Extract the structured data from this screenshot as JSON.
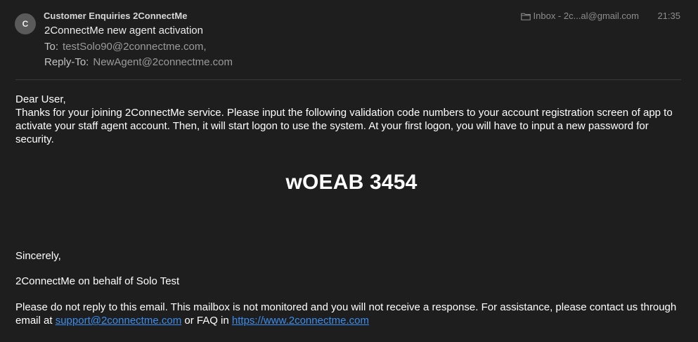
{
  "header": {
    "avatar_letter": "C",
    "sender": "Customer Enquiries 2ConnectMe",
    "subject": "2ConnectMe new agent activation",
    "to_label": "To:",
    "to_value": "testSolo90@2connectme.com,",
    "reply_to_label": "Reply-To:",
    "reply_to_value": "NewAgent@2connectme.com",
    "mailbox_icon": "folder-icon",
    "mailbox": "Inbox - 2c...al@gmail.com",
    "time": "21:35"
  },
  "body": {
    "greeting": "Dear User,",
    "paragraph": "Thanks for your joining 2ConnectMe service. Please input the following validation code numbers to your account registration screen of app to activate your staff agent account. Then, it will start logon to use the system. At your first logon, you will have to input a new password for security.",
    "code": "wOEAB 3454",
    "sincerely": "Sincerely,",
    "signature": "2ConnectMe on behalf of Solo Test",
    "footer_text_1": "Please do not reply to this email. This mailbox is not monitored and you will not receive a response. For assistance, please contact us through email at",
    "footer_email": "support@2connectme.com",
    "footer_text_2": "or FAQ in",
    "footer_url": "https://www.2connectme.com"
  },
  "colors": {
    "background": "#1e1e1e",
    "link": "#3b8ef0",
    "secondary_text": "#9a9a9a"
  }
}
